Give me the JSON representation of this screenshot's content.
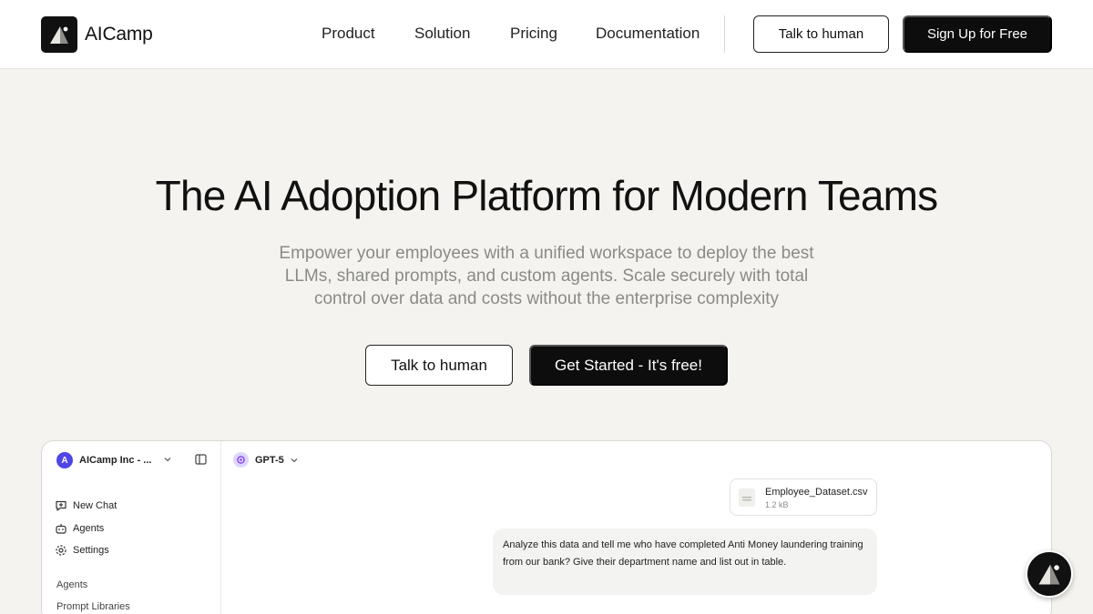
{
  "brand": {
    "name": "AICamp"
  },
  "nav": {
    "links": [
      "Product",
      "Solution",
      "Pricing",
      "Documentation"
    ],
    "talk_label": "Talk to human",
    "signup_label": "Sign Up for Free"
  },
  "hero": {
    "title": "The AI Adoption Platform for Modern Teams",
    "subtitle": "Empower your employees with a unified workspace to deploy the best LLMs, shared prompts, and custom agents. Scale securely with total control over data and costs without the enterprise complexity",
    "talk_label": "Talk to human",
    "cta_label": "Get Started - It's free!"
  },
  "app": {
    "workspace": {
      "initial": "A",
      "name": "AICamp Inc - ..."
    },
    "sidebar": {
      "items": [
        {
          "label": "New Chat",
          "icon": "new-chat-icon"
        },
        {
          "label": "Agents",
          "icon": "robot-icon"
        },
        {
          "label": "Settings",
          "icon": "gear-icon"
        }
      ],
      "sections": [
        "Agents",
        "Prompt Libraries"
      ]
    },
    "model": {
      "name": "GPT-5"
    },
    "file": {
      "name": "Employee_Dataset.csv",
      "size": "1.2 kB"
    },
    "message": "Analyze this data and tell me who have completed Anti Money laundering training from our bank? Give their department name and list out in table."
  },
  "colors": {
    "page_bg": "#f4f3ef",
    "dark": "#0d0d0d",
    "workspace_avatar": "#4f46e5",
    "model_icon_bg": "#ddd6fe",
    "muted_text": "#8a8a88"
  }
}
